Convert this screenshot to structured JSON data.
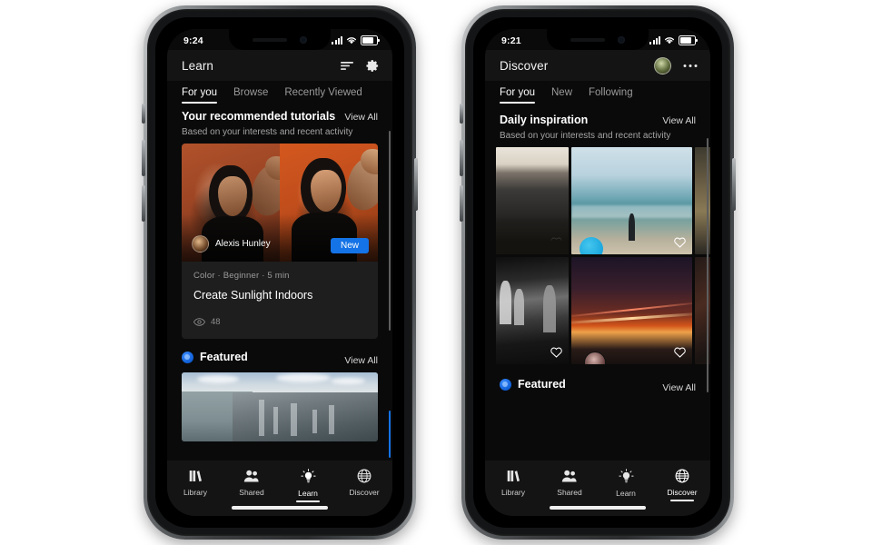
{
  "scene": {
    "background": "#ffffff",
    "accent_blue": "#1473e6"
  },
  "left_phone": {
    "status_bar": {
      "time": "9:24",
      "signal_icon": "cellular-bars-icon",
      "wifi_icon": "wifi-icon",
      "battery_icon": "battery-icon"
    },
    "app_bar": {
      "title": "Learn",
      "sort_icon": "sort-filter-icon",
      "settings_icon": "gear-icon"
    },
    "tabs": [
      {
        "label": "For you",
        "active": true
      },
      {
        "label": "Browse",
        "active": false
      },
      {
        "label": "Recently Viewed",
        "active": false
      }
    ],
    "recommended": {
      "title": "Your recommended tutorials",
      "view_all": "View All",
      "subtitle": "Based on your interests and recent activity"
    },
    "tutorial_card": {
      "author": "Alexis Hunley",
      "badge": "New",
      "meta": "Color  ·  Beginner  ·  5 min",
      "title": "Create Sunlight Indoors",
      "views_icon": "eye-icon",
      "views": "48"
    },
    "featured": {
      "badge_icon": "featured-badge-icon",
      "title": "Featured",
      "view_all": "View All"
    },
    "nav": [
      {
        "label": "Library",
        "icon": "library-books-icon",
        "active": false
      },
      {
        "label": "Shared",
        "icon": "people-shared-icon",
        "active": false
      },
      {
        "label": "Learn",
        "icon": "lightbulb-icon",
        "active": true
      },
      {
        "label": "Discover",
        "icon": "globe-icon",
        "active": false
      }
    ]
  },
  "right_phone": {
    "status_bar": {
      "time": "9:21",
      "signal_icon": "cellular-bars-icon",
      "wifi_icon": "wifi-icon",
      "battery_icon": "battery-icon"
    },
    "app_bar": {
      "title": "Discover",
      "avatar_icon": "profile-avatar",
      "more_icon": "more-options-icon"
    },
    "tabs": [
      {
        "label": "For you",
        "active": true
      },
      {
        "label": "New",
        "active": false
      },
      {
        "label": "Following",
        "active": false
      }
    ],
    "daily": {
      "title": "Daily inspiration",
      "view_all": "View All",
      "subtitle": "Based on your interests and recent activity"
    },
    "photos": [
      {
        "name": "photo-coastal-cliff",
        "like_icon": "heart-icon"
      },
      {
        "name": "photo-beach-walker",
        "like_icon": "heart-icon"
      },
      {
        "name": "photo-forest-trail",
        "like_icon": ""
      },
      {
        "name": "photo-street-bw",
        "like_icon": "heart-icon"
      },
      {
        "name": "photo-night-lights",
        "like_icon": "heart-icon"
      },
      {
        "name": "photo-dark-abstract",
        "like_icon": ""
      }
    ],
    "featured": {
      "badge_icon": "featured-badge-icon",
      "title": "Featured",
      "view_all": "View All"
    },
    "nav": [
      {
        "label": "Library",
        "icon": "library-books-icon",
        "active": false
      },
      {
        "label": "Shared",
        "icon": "people-shared-icon",
        "active": false
      },
      {
        "label": "Learn",
        "icon": "lightbulb-icon",
        "active": false
      },
      {
        "label": "Discover",
        "icon": "globe-icon",
        "active": true
      }
    ]
  }
}
